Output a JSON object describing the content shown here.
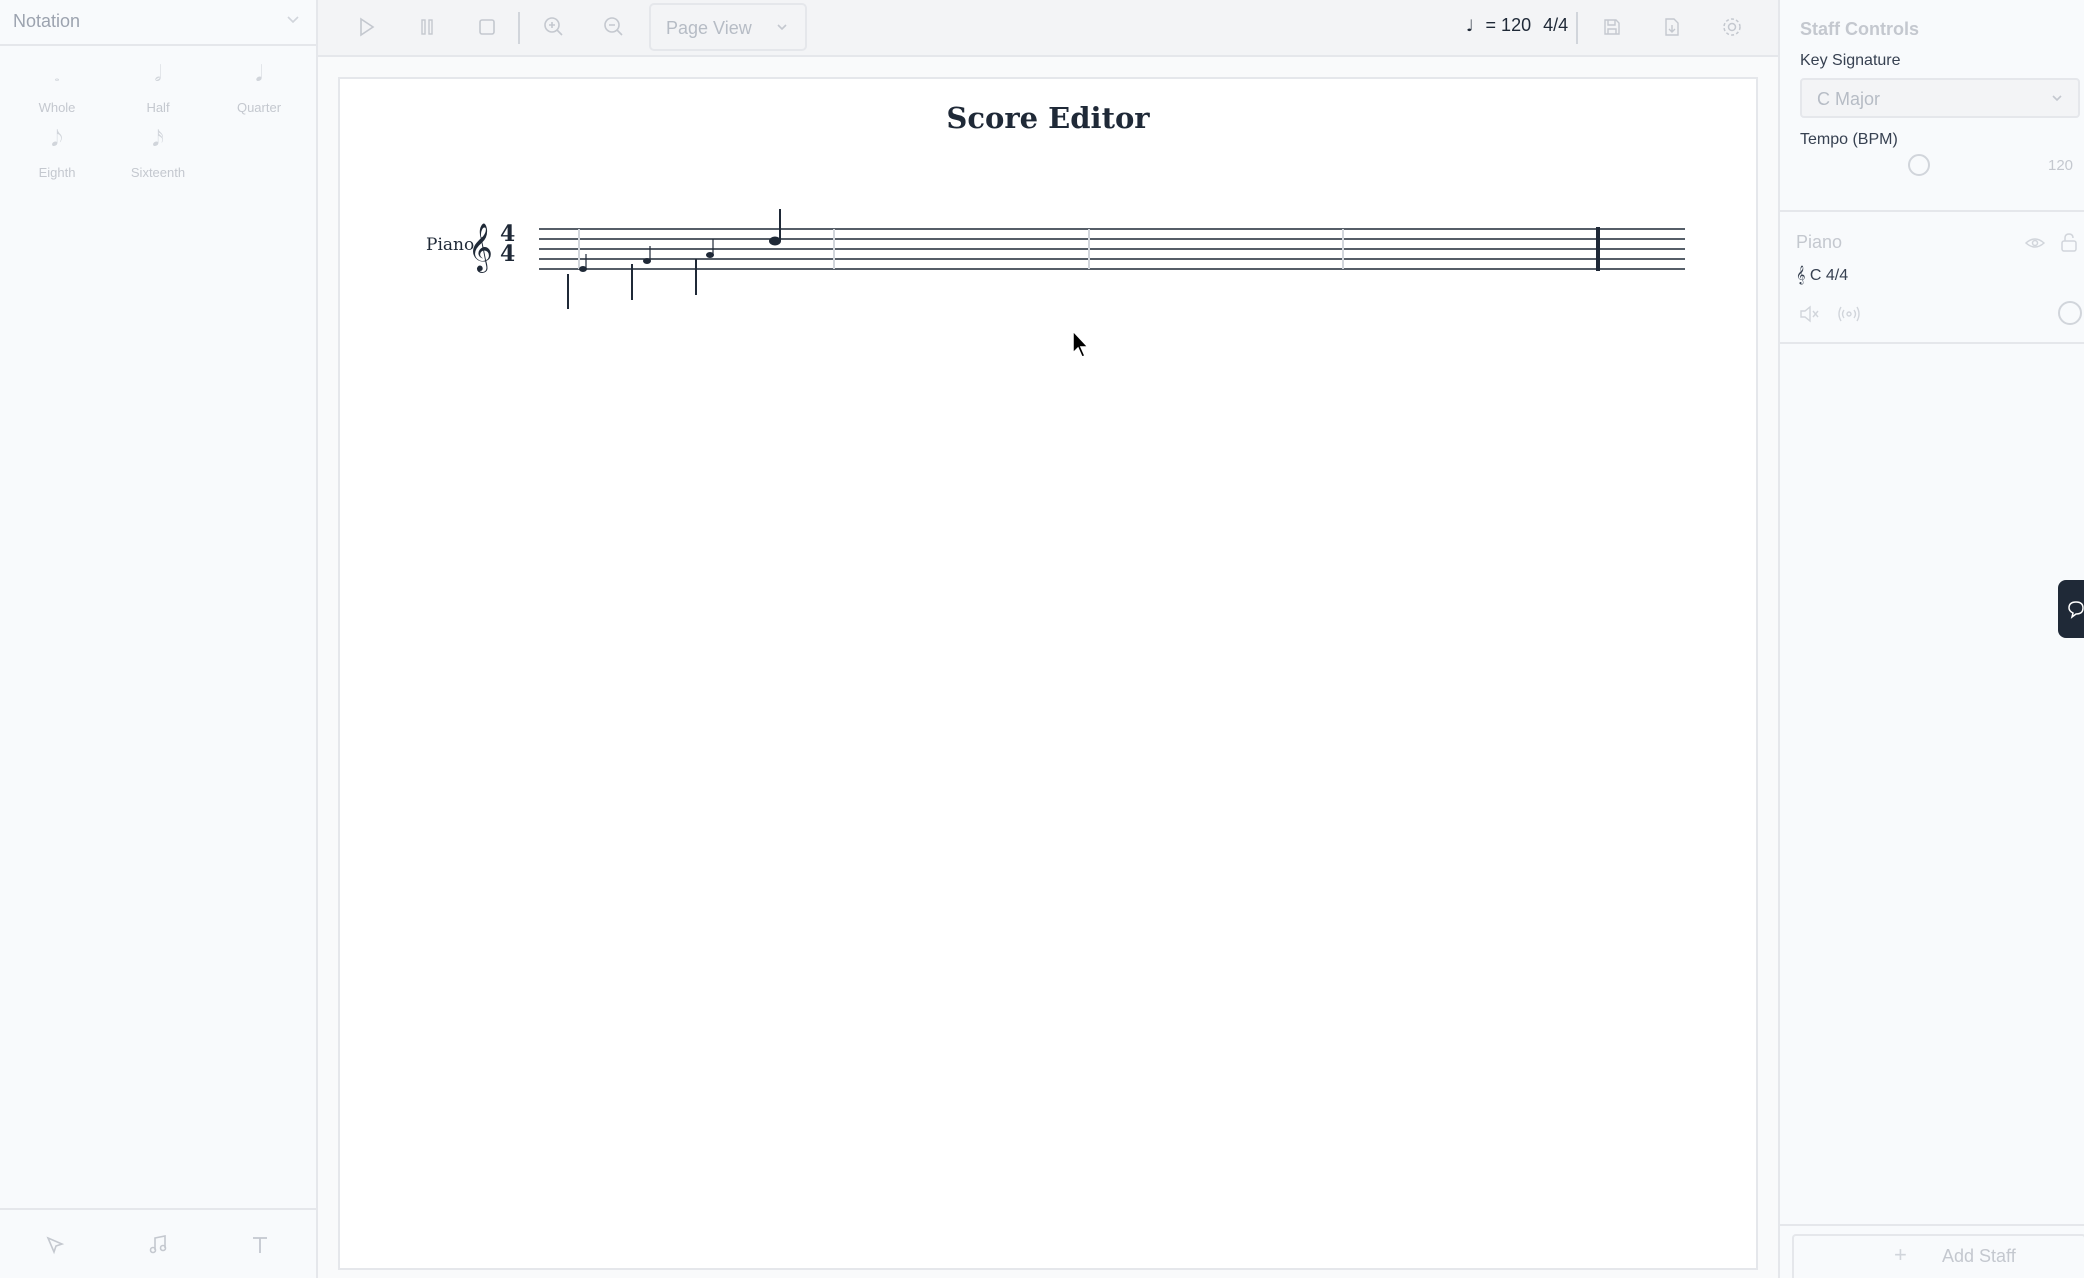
{
  "left_panel": {
    "title": "Notation",
    "note_tools": [
      {
        "label": "Whole",
        "glyph": "𝅝"
      },
      {
        "label": "Half",
        "glyph": "𝅗𝅥"
      },
      {
        "label": "Quarter",
        "glyph": "𝅘𝅥"
      },
      {
        "label": "Eighth",
        "glyph": "𝅘𝅥𝅮"
      },
      {
        "label": "Sixteenth",
        "glyph": "𝅘𝅥𝅯"
      }
    ],
    "bottom_tools": [
      "select-icon",
      "music-note-icon",
      "text-icon"
    ]
  },
  "toolbar": {
    "buttons": [
      "play-icon",
      "pause-icon",
      "stop-icon",
      "zoom-in-icon",
      "zoom-out-icon",
      "save-icon",
      "export-icon",
      "settings-icon"
    ],
    "view_mode": "Page View",
    "tempo_note": "♩",
    "tempo_text": "= 120",
    "time_signature": "4/4"
  },
  "score": {
    "title": "Score Editor",
    "instrument": "Piano",
    "clef": "𝄞",
    "time_sig_top": "4",
    "time_sig_bottom": "4"
  },
  "right_panel": {
    "section_title": "Staff Controls",
    "key_signature_label": "Key Signature",
    "key_signature_value": "C Major",
    "tempo_label": "Tempo (BPM)",
    "tempo_value": "120",
    "staff_card": {
      "name": "Piano",
      "meta": "𝄞 C 4/4"
    },
    "add_staff_label": "Add Staff"
  },
  "colors": {
    "accent_dark": "#1f2937",
    "muted": "#c4c8cf",
    "border": "#e5e7eb"
  }
}
